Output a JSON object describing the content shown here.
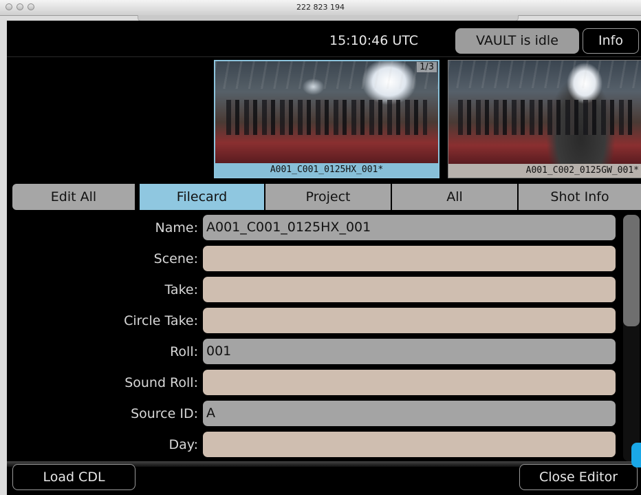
{
  "window": {
    "title": "222 823 194"
  },
  "header": {
    "time": "15:10:46 UTC",
    "status": "VAULT is idle",
    "info_label": "Info"
  },
  "thumbnails": [
    {
      "caption": "A001_C001_0125HX_001*",
      "counter": "1/3",
      "selected": true
    },
    {
      "caption": "A001_C002_0125GW_001*",
      "selected": false
    }
  ],
  "tabs": [
    "Edit All",
    "Filecard",
    "Project",
    "All",
    "Shot Info"
  ],
  "active_tab": "Filecard",
  "fields": [
    {
      "label": "Name:",
      "value": "A001_C001_0125HX_001"
    },
    {
      "label": "Scene:",
      "value": ""
    },
    {
      "label": "Take:",
      "value": ""
    },
    {
      "label": "Circle Take:",
      "value": ""
    },
    {
      "label": "Roll:",
      "value": "001"
    },
    {
      "label": "Sound Roll:",
      "value": ""
    },
    {
      "label": "Source ID:",
      "value": "A"
    },
    {
      "label": "Day:",
      "value": ""
    }
  ],
  "footer": {
    "load_cdl": "Load CDL",
    "close_editor": "Close Editor"
  },
  "colors": {
    "active_tab": "#8fc7e0",
    "readonly_field": "#a4a4a4",
    "editable_field": "#cfbeb0"
  }
}
